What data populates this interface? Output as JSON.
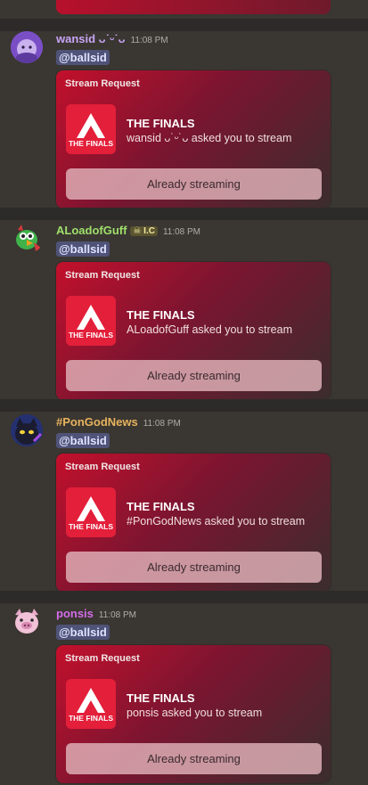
{
  "messages": [
    {
      "username": "wansid ᴗ˙ᵕ˙ᴗ",
      "time": "11:08 PM",
      "tag": "",
      "name_color": "#c7a4f5",
      "mention": "@ballsid",
      "card": {
        "title": "Stream Request",
        "game_name": "THE FINALS",
        "request_text": "wansid ᴗ˙ᵕ˙ᴗ asked you to stream",
        "button_label": "Already streaming"
      }
    },
    {
      "username": "ALoadofGuff",
      "time": "11:08 PM",
      "tag": "I.C",
      "name_color": "#9fe06b",
      "mention": "@ballsid",
      "card": {
        "title": "Stream Request",
        "game_name": "THE FINALS",
        "request_text": "ALoadofGuff asked you to stream",
        "button_label": "Already streaming"
      }
    },
    {
      "username": "#PonGodNews",
      "time": "11:08 PM",
      "tag": "",
      "name_color": "#e7b35d",
      "mention": "@ballsid",
      "card": {
        "title": "Stream Request",
        "game_name": "THE FINALS",
        "request_text": "#PonGodNews asked you to stream",
        "button_label": "Already streaming"
      }
    },
    {
      "username": "ponsis",
      "time": "11:08 PM",
      "tag": "",
      "name_color": "#d36ce8",
      "mention": "@ballsid",
      "card": {
        "title": "Stream Request",
        "game_name": "THE FINALS",
        "request_text": "ponsis asked you to stream",
        "button_label": "Already streaming"
      }
    }
  ],
  "icons": {
    "game": "the-finals-logo-icon",
    "tag_emoji": "skull-icon"
  },
  "colors": {
    "background": "#3a3631",
    "card_accent": "#c3102c",
    "mention_bg": "#4f5378"
  }
}
